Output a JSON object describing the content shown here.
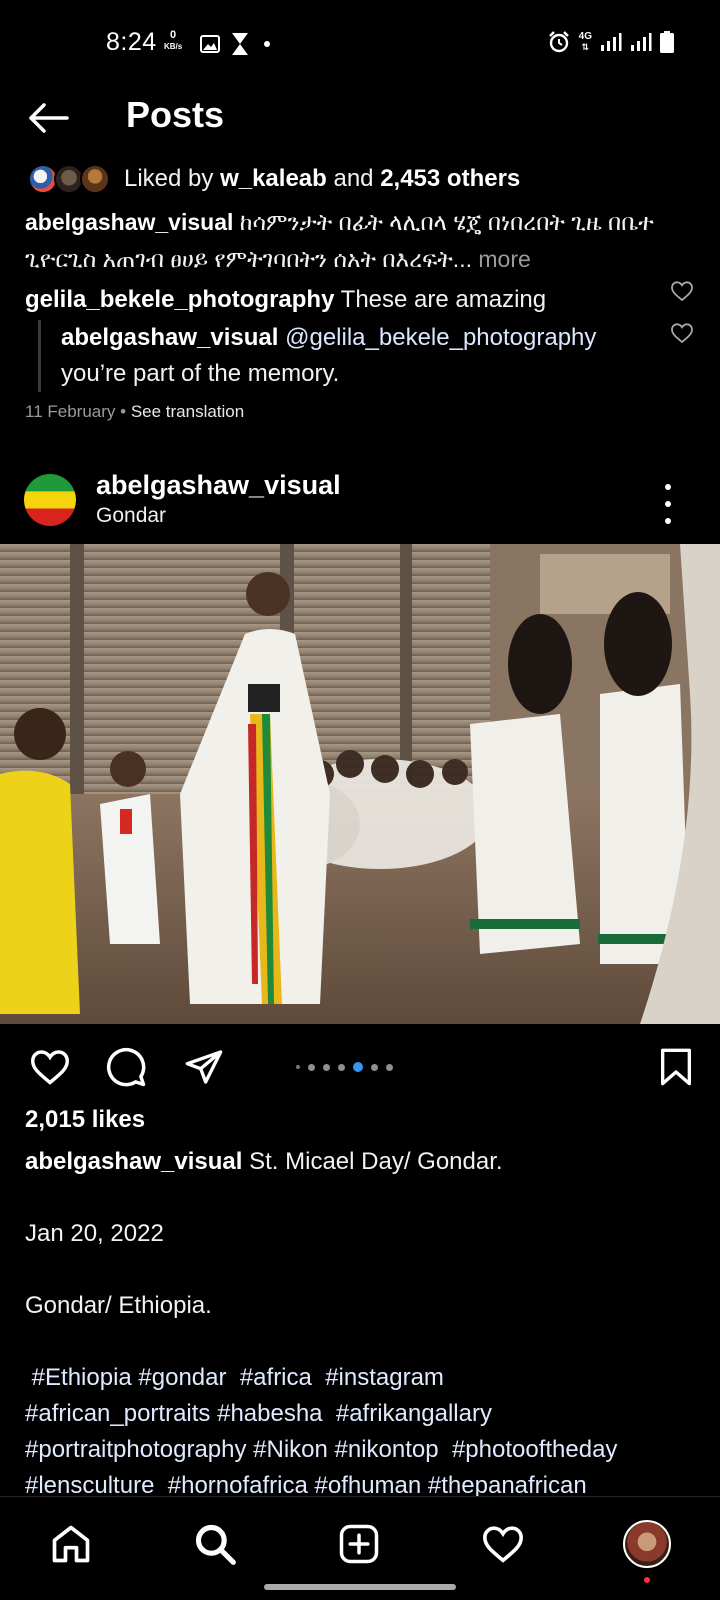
{
  "status_bar": {
    "time": "8:24",
    "data_rate_value": "0",
    "data_rate_unit": "KB/s",
    "network_label": "4G"
  },
  "header": {
    "title": "Posts"
  },
  "previous_post": {
    "liked_prefix": "Liked by ",
    "liked_user": "w_kaleab",
    "liked_and": " and ",
    "liked_others": "2,453 others",
    "caption_user": "abelgashaw_visual",
    "caption_text": " ከሳምንታት በፊት ላሊበላ ሄጄ በነበረበት ጊዜ በቤተ ጊዮርጊስ አጠገብ ፀሀይ የምትገባበትን ሰአት በእረፍት...",
    "more_label": " more",
    "comment_user": "gelila_bekele_photography",
    "comment_text": " These are amazing",
    "reply_user": "abelgashaw_visual",
    "reply_mention": " @gelila_bekele_photography",
    "reply_text": "you’re part of the memory.",
    "date": "11 February",
    "separator": " • ",
    "see_translation": "See translation"
  },
  "post": {
    "username": "abelgashaw_visual",
    "location": "Gondar",
    "likes": "2,015 likes",
    "caption_user": "abelgashaw_visual",
    "caption_lines": [
      " St. Micael Day/ Gondar.",
      "",
      "Jan 20, 2022",
      "",
      "Gondar/ Ethiopia.",
      "",
      " #Ethiopia #gondar  #africa  #instagram",
      "#african_portraits #habesha  #afrikangallary",
      "#portraitphotography #Nikon #nikontop  #photooftheday",
      "#lensculture  #hornofafrica #ofhuman #thepanafrican"
    ],
    "carousel": {
      "count": 6,
      "active_index": 4
    }
  },
  "nav": {
    "items": [
      "home-icon",
      "search-icon",
      "create-icon",
      "activity-icon",
      "profile-avatar"
    ]
  },
  "colors": {
    "background": "#000000",
    "accent_blue": "#3797f0",
    "notification_red": "#ff3040",
    "flag_green": "#1f9a3a",
    "flag_yellow": "#f6d40b",
    "flag_red": "#d9231e"
  }
}
